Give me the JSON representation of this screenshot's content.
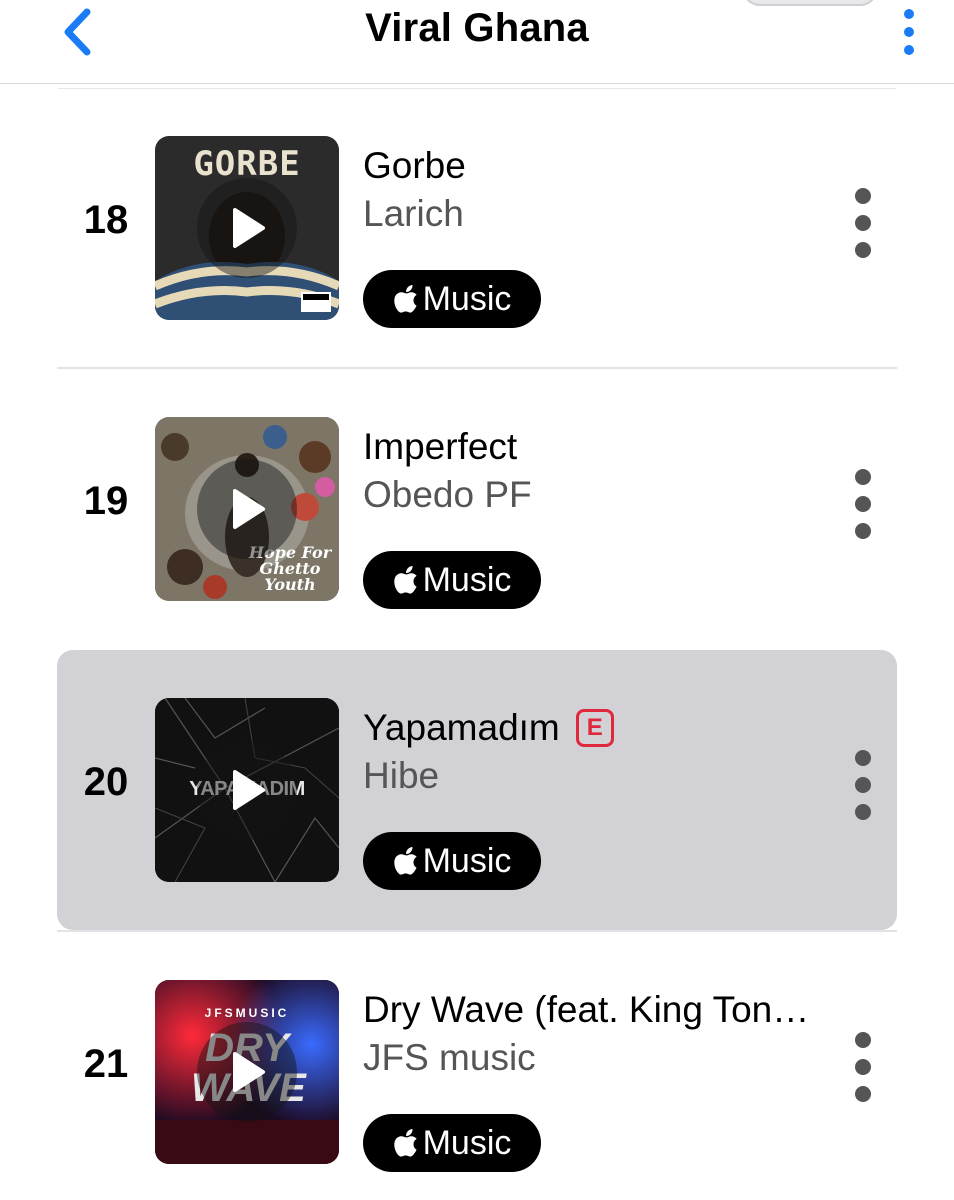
{
  "header": {
    "title": "Viral Ghana",
    "accent": "#1a7cf5"
  },
  "rows": [
    {
      "rank": "18",
      "song": "Gorbe",
      "artist": "Larich",
      "explicit": false,
      "cover_text": "GORBE",
      "cover_advisory": "PARENTAL ADVISORY"
    },
    {
      "rank": "19",
      "song": "Imperfect",
      "artist": "Obedo PF",
      "explicit": false,
      "cover_text": "Hope For Ghetto Youth"
    },
    {
      "rank": "20",
      "song": "Yapamadım",
      "artist": "Hibe",
      "explicit": true,
      "explicit_label": "E",
      "highlighted": true,
      "cover_text": "YAPAMADIM"
    },
    {
      "rank": "21",
      "song": "Dry Wave (feat. King Ton…",
      "artist": "JFS music",
      "explicit": false,
      "cover_text_top": "JFSMUSIC",
      "cover_text": "DRY WAVE"
    }
  ],
  "music_button": {
    "label": "Music",
    "icon": "apple-logo-icon"
  },
  "colors": {
    "highlight": "#d1d1d6",
    "explicit": "#e0283d",
    "artist": "#555558"
  }
}
